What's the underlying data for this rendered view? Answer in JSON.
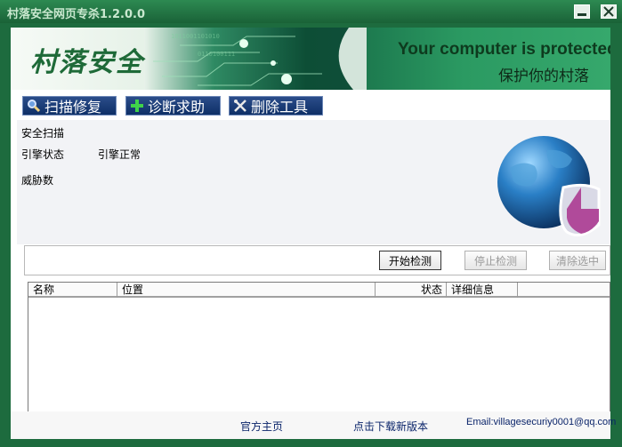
{
  "window": {
    "title": "村落安全网页专杀1.2.0.0"
  },
  "banner": {
    "logo_text": "村落安全",
    "tagline_en": "Your computer is protected",
    "tagline_cn": "保护你的村落"
  },
  "toolbar": {
    "tabs": [
      {
        "label": "扫描修复",
        "icon": "magnifier-icon"
      },
      {
        "label": "诊断求助",
        "icon": "plus-icon"
      },
      {
        "label": "删除工具",
        "icon": "tools-icon"
      }
    ]
  },
  "scan_panel": {
    "section_title": "安全扫描",
    "engine_status_label": "引擎状态",
    "engine_status_value": "引擎正常",
    "threat_count_label": "威胁数"
  },
  "actions": {
    "start_label": "开始检测",
    "stop_label": "停止检测",
    "clear_label": "清除选中"
  },
  "results_table": {
    "columns": [
      "名称",
      "位置",
      "状态",
      "详细信息"
    ],
    "rows": []
  },
  "footer": {
    "homepage_link": "官方主页",
    "download_link": "点击下载新版本",
    "email": "Email:villagesecuriy0001@qq.com"
  },
  "colors": {
    "frame": "#1d6b3e",
    "tab_bg": "#0e2f66",
    "link": "#0a246a"
  }
}
